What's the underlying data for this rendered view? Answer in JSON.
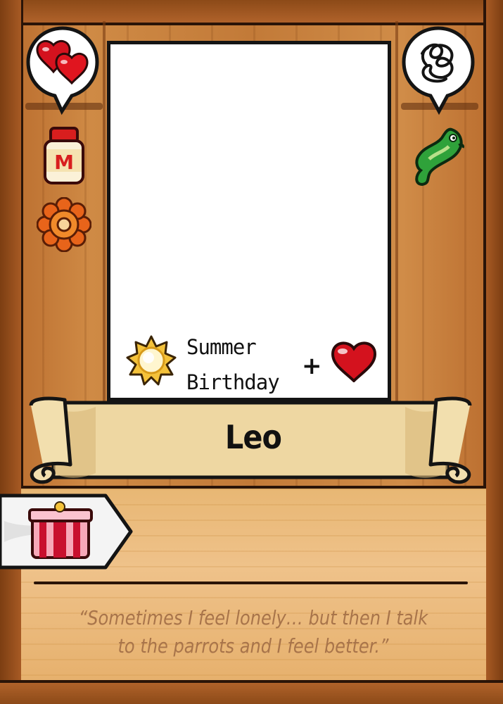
{
  "card": {
    "character_name": "Leo",
    "birthday": {
      "season_line1": "Summer",
      "season_line2": "Birthday",
      "plus": "+",
      "season_icon": "sun-icon",
      "reward_icon": "heart-icon"
    },
    "loves_bubble_icon": "two-hearts-icon",
    "loved_items": [
      "mayonnaise-jar-icon",
      "orange-flower-icon"
    ],
    "dislikes_bubble_icon": "scribble-icon",
    "disliked_items": [
      "green-fish-icon"
    ],
    "gift_icon": "gift-box-icon",
    "quote": "“Sometimes I feel lonely… but then I talk to the parrots and I feel better.”"
  },
  "colors": {
    "wood": "#c27a38",
    "panel": "#efc28a",
    "quote_text": "#a8744a",
    "heart": "#d4121e"
  }
}
